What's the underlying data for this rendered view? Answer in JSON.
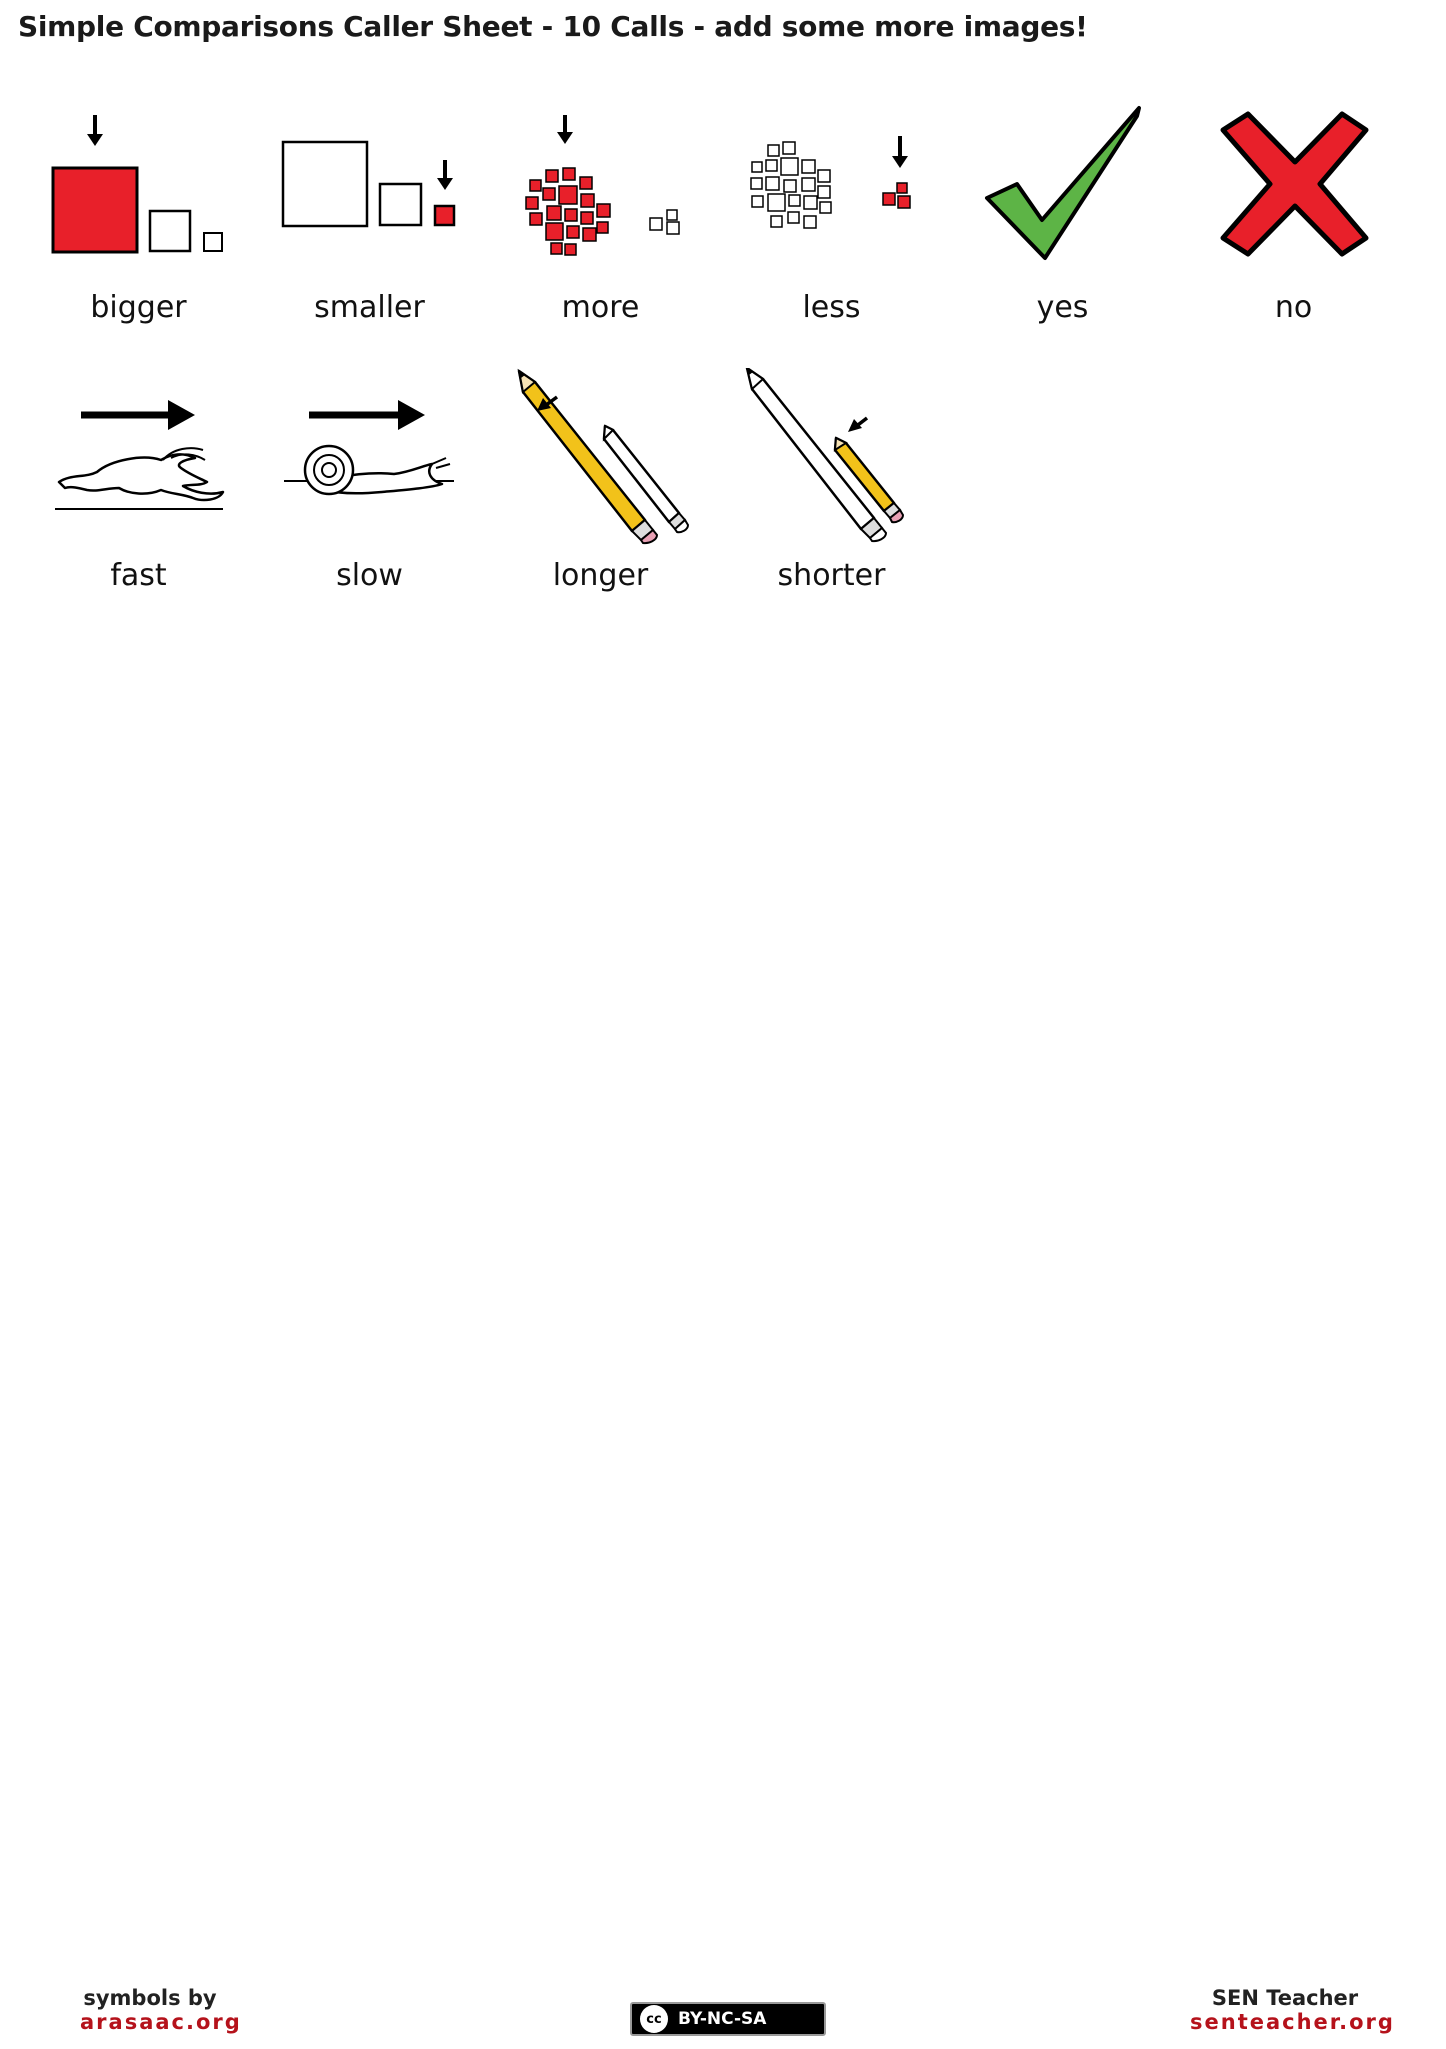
{
  "title": "Simple Comparisons Caller Sheet - 10 Calls - add some more images!",
  "cards": [
    {
      "label": "bigger",
      "icon": "bigger-squares-icon"
    },
    {
      "label": "smaller",
      "icon": "smaller-squares-icon"
    },
    {
      "label": "more",
      "icon": "more-dots-icon"
    },
    {
      "label": "less",
      "icon": "less-dots-icon"
    },
    {
      "label": "yes",
      "icon": "green-check-icon"
    },
    {
      "label": "no",
      "icon": "red-x-icon"
    },
    {
      "label": "fast",
      "icon": "running-hare-icon"
    },
    {
      "label": "slow",
      "icon": "snail-icon"
    },
    {
      "label": "longer",
      "icon": "long-pencil-icon"
    },
    {
      "label": "shorter",
      "icon": "short-pencil-icon"
    }
  ],
  "footer": {
    "left_line1": "symbols by",
    "left_line2": "arasaac.org",
    "license": "BY-NC-SA",
    "license_mark": "cc",
    "right_line1": "SEN Teacher",
    "right_line2": "senteacher.org"
  },
  "colors": {
    "accent_red": "#e8202a",
    "check_green": "#5db446",
    "pencil_yellow": "#f2c21a",
    "footer_red": "#b5121b"
  }
}
